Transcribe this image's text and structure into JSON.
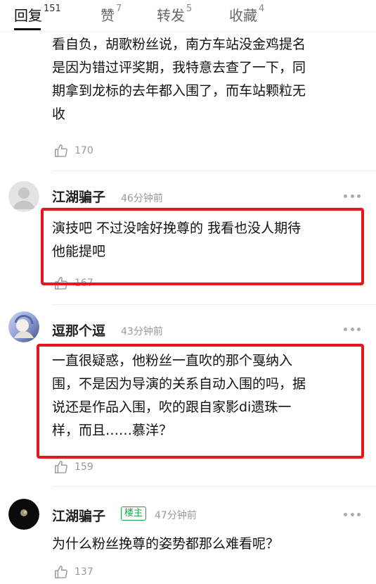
{
  "tabs": [
    {
      "label": "回复",
      "count": "151",
      "active": true
    },
    {
      "label": "赞",
      "count": "7",
      "active": false
    },
    {
      "label": "转发",
      "count": "5",
      "active": false
    },
    {
      "label": "收藏",
      "count": "4",
      "active": false
    }
  ],
  "top_comment": {
    "lines": [
      "看自负，胡歌粉丝说，南方车站没金鸡提名",
      "是因为错过评奖期，我特意去查了一下，同",
      "期拿到龙标的去年都入围了，而车站颗粒无",
      "收"
    ],
    "likes": "170"
  },
  "comments": [
    {
      "username": "江湖骗子",
      "time": "46分钟前",
      "lines": [
        "演技吧 不过没啥好挽尊的 我看也没人期待",
        "他能提吧"
      ],
      "likes": "167",
      "avatar": "default-avatar"
    },
    {
      "username": "逗那个逗",
      "time": "43分钟前",
      "lines": [
        "一直很疑惑，他粉丝一直吹的那个戛纳入",
        "围，不是因为导演的关系自动入围的吗，据",
        "说还是作品入围，吹的跟自家影di遗珠一",
        "样，而且……慕洋？"
      ],
      "likes": "159",
      "avatar": "anime-avatar"
    },
    {
      "username": "江湖骗子",
      "badge": "楼主",
      "time": "47分钟前",
      "lines": [
        "为什么粉丝挽尊的姿势都那么难看呢？"
      ],
      "likes": "137",
      "avatar": "dark-moon-avatar"
    }
  ],
  "colors": {
    "highlight": "#e8151b",
    "badge": "#1aa64f"
  }
}
